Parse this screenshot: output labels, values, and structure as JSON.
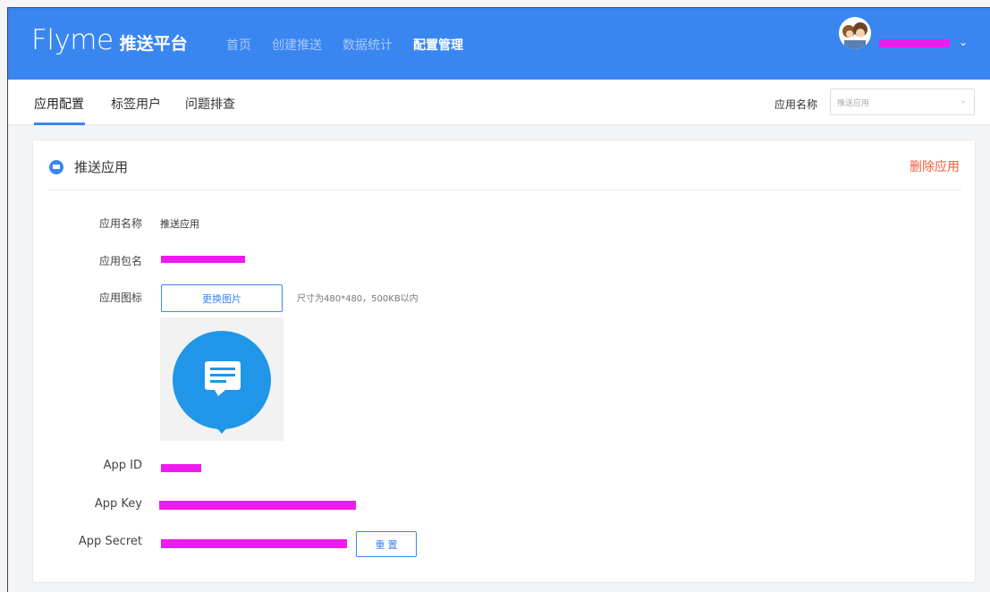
{
  "header": {
    "logo_brand": "Flyme",
    "logo_product": "推送平台",
    "nav": [
      {
        "label": "首页",
        "active": false
      },
      {
        "label": "创建推送",
        "active": false
      },
      {
        "label": "数据统计",
        "active": false
      },
      {
        "label": "配置管理",
        "active": true
      }
    ],
    "user_menu_icon": "chevron-down-icon"
  },
  "subnav": {
    "tabs": [
      {
        "label": "应用配置",
        "active": true
      },
      {
        "label": "标签用户",
        "active": false
      },
      {
        "label": "问题排查",
        "active": false
      }
    ],
    "app_name_label": "应用名称",
    "app_select_value": "推送应用"
  },
  "card": {
    "title": "推送应用",
    "delete_label": "删除应用",
    "fields": {
      "app_name_label": "应用名称",
      "app_name_value": "推送应用",
      "package_label": "应用包名",
      "icon_label": "应用图标",
      "change_image_label": "更换图片",
      "icon_hint": "尺寸为480*480，500KB以内",
      "app_id_label": "App ID",
      "app_key_label": "App Key",
      "app_secret_label": "App Secret",
      "reset_label": "重 置"
    }
  },
  "colors": {
    "primary": "#3a86f0",
    "danger": "#f25b3b",
    "redaction": "#ee1bee",
    "icon_bubble": "#2196e8"
  }
}
